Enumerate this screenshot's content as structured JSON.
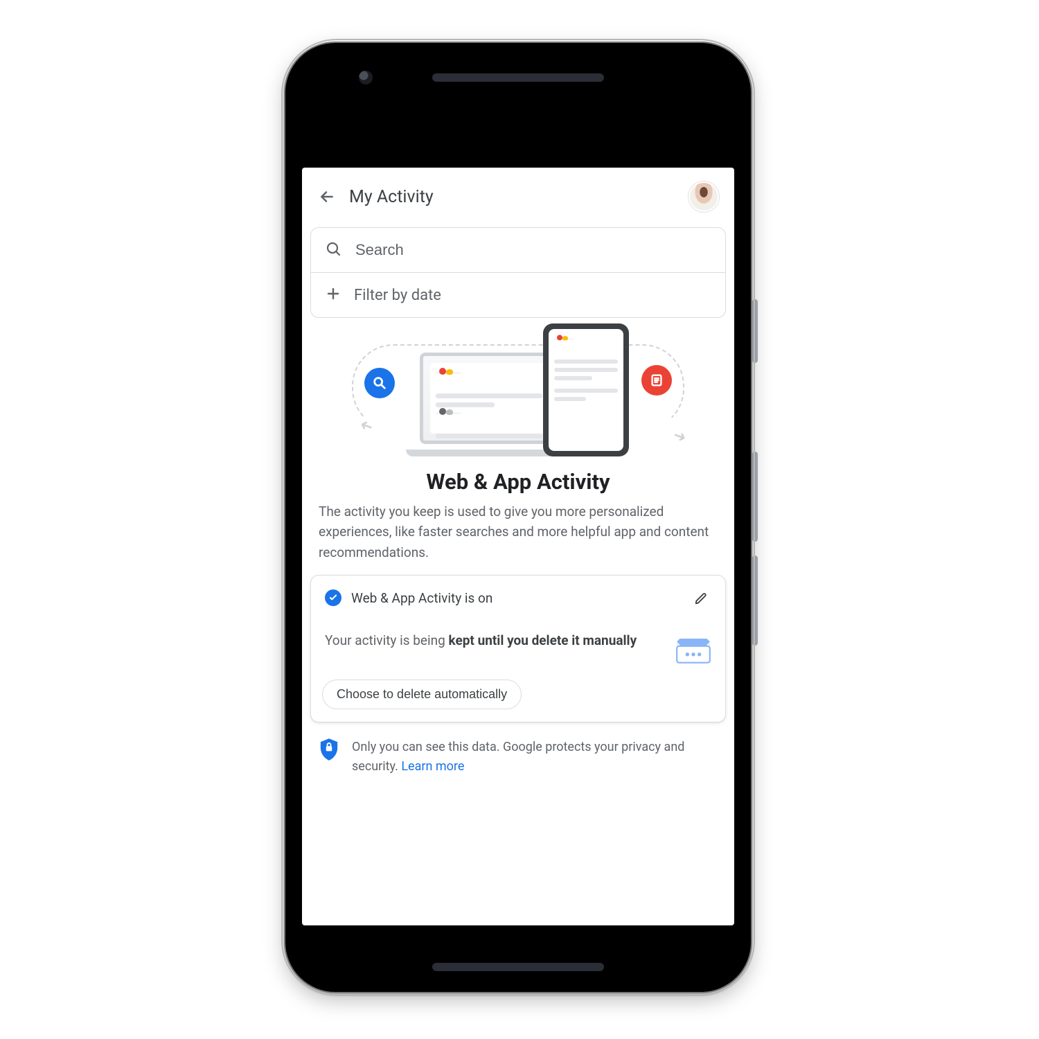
{
  "header": {
    "title": "My Activity"
  },
  "search": {
    "placeholder": "Search",
    "filter_label": "Filter by date"
  },
  "main": {
    "heading": "Web & App Activity",
    "description": "The activity you keep is used to give you more personalized experiences, like faster searches and more helpful app and content recommendations."
  },
  "card": {
    "status_text": "Web & App Activity is on",
    "keep_prefix": "Your activity is being",
    "keep_bold": "kept until you delete it manually",
    "auto_delete_label": "Choose to delete automatically"
  },
  "privacy": {
    "text": "Only you can see this data. Google protects your privacy and security. ",
    "link_label": "Learn more"
  },
  "colors": {
    "accent": "#1a73e8",
    "danger": "#ea4335",
    "muted": "#5f6368"
  }
}
